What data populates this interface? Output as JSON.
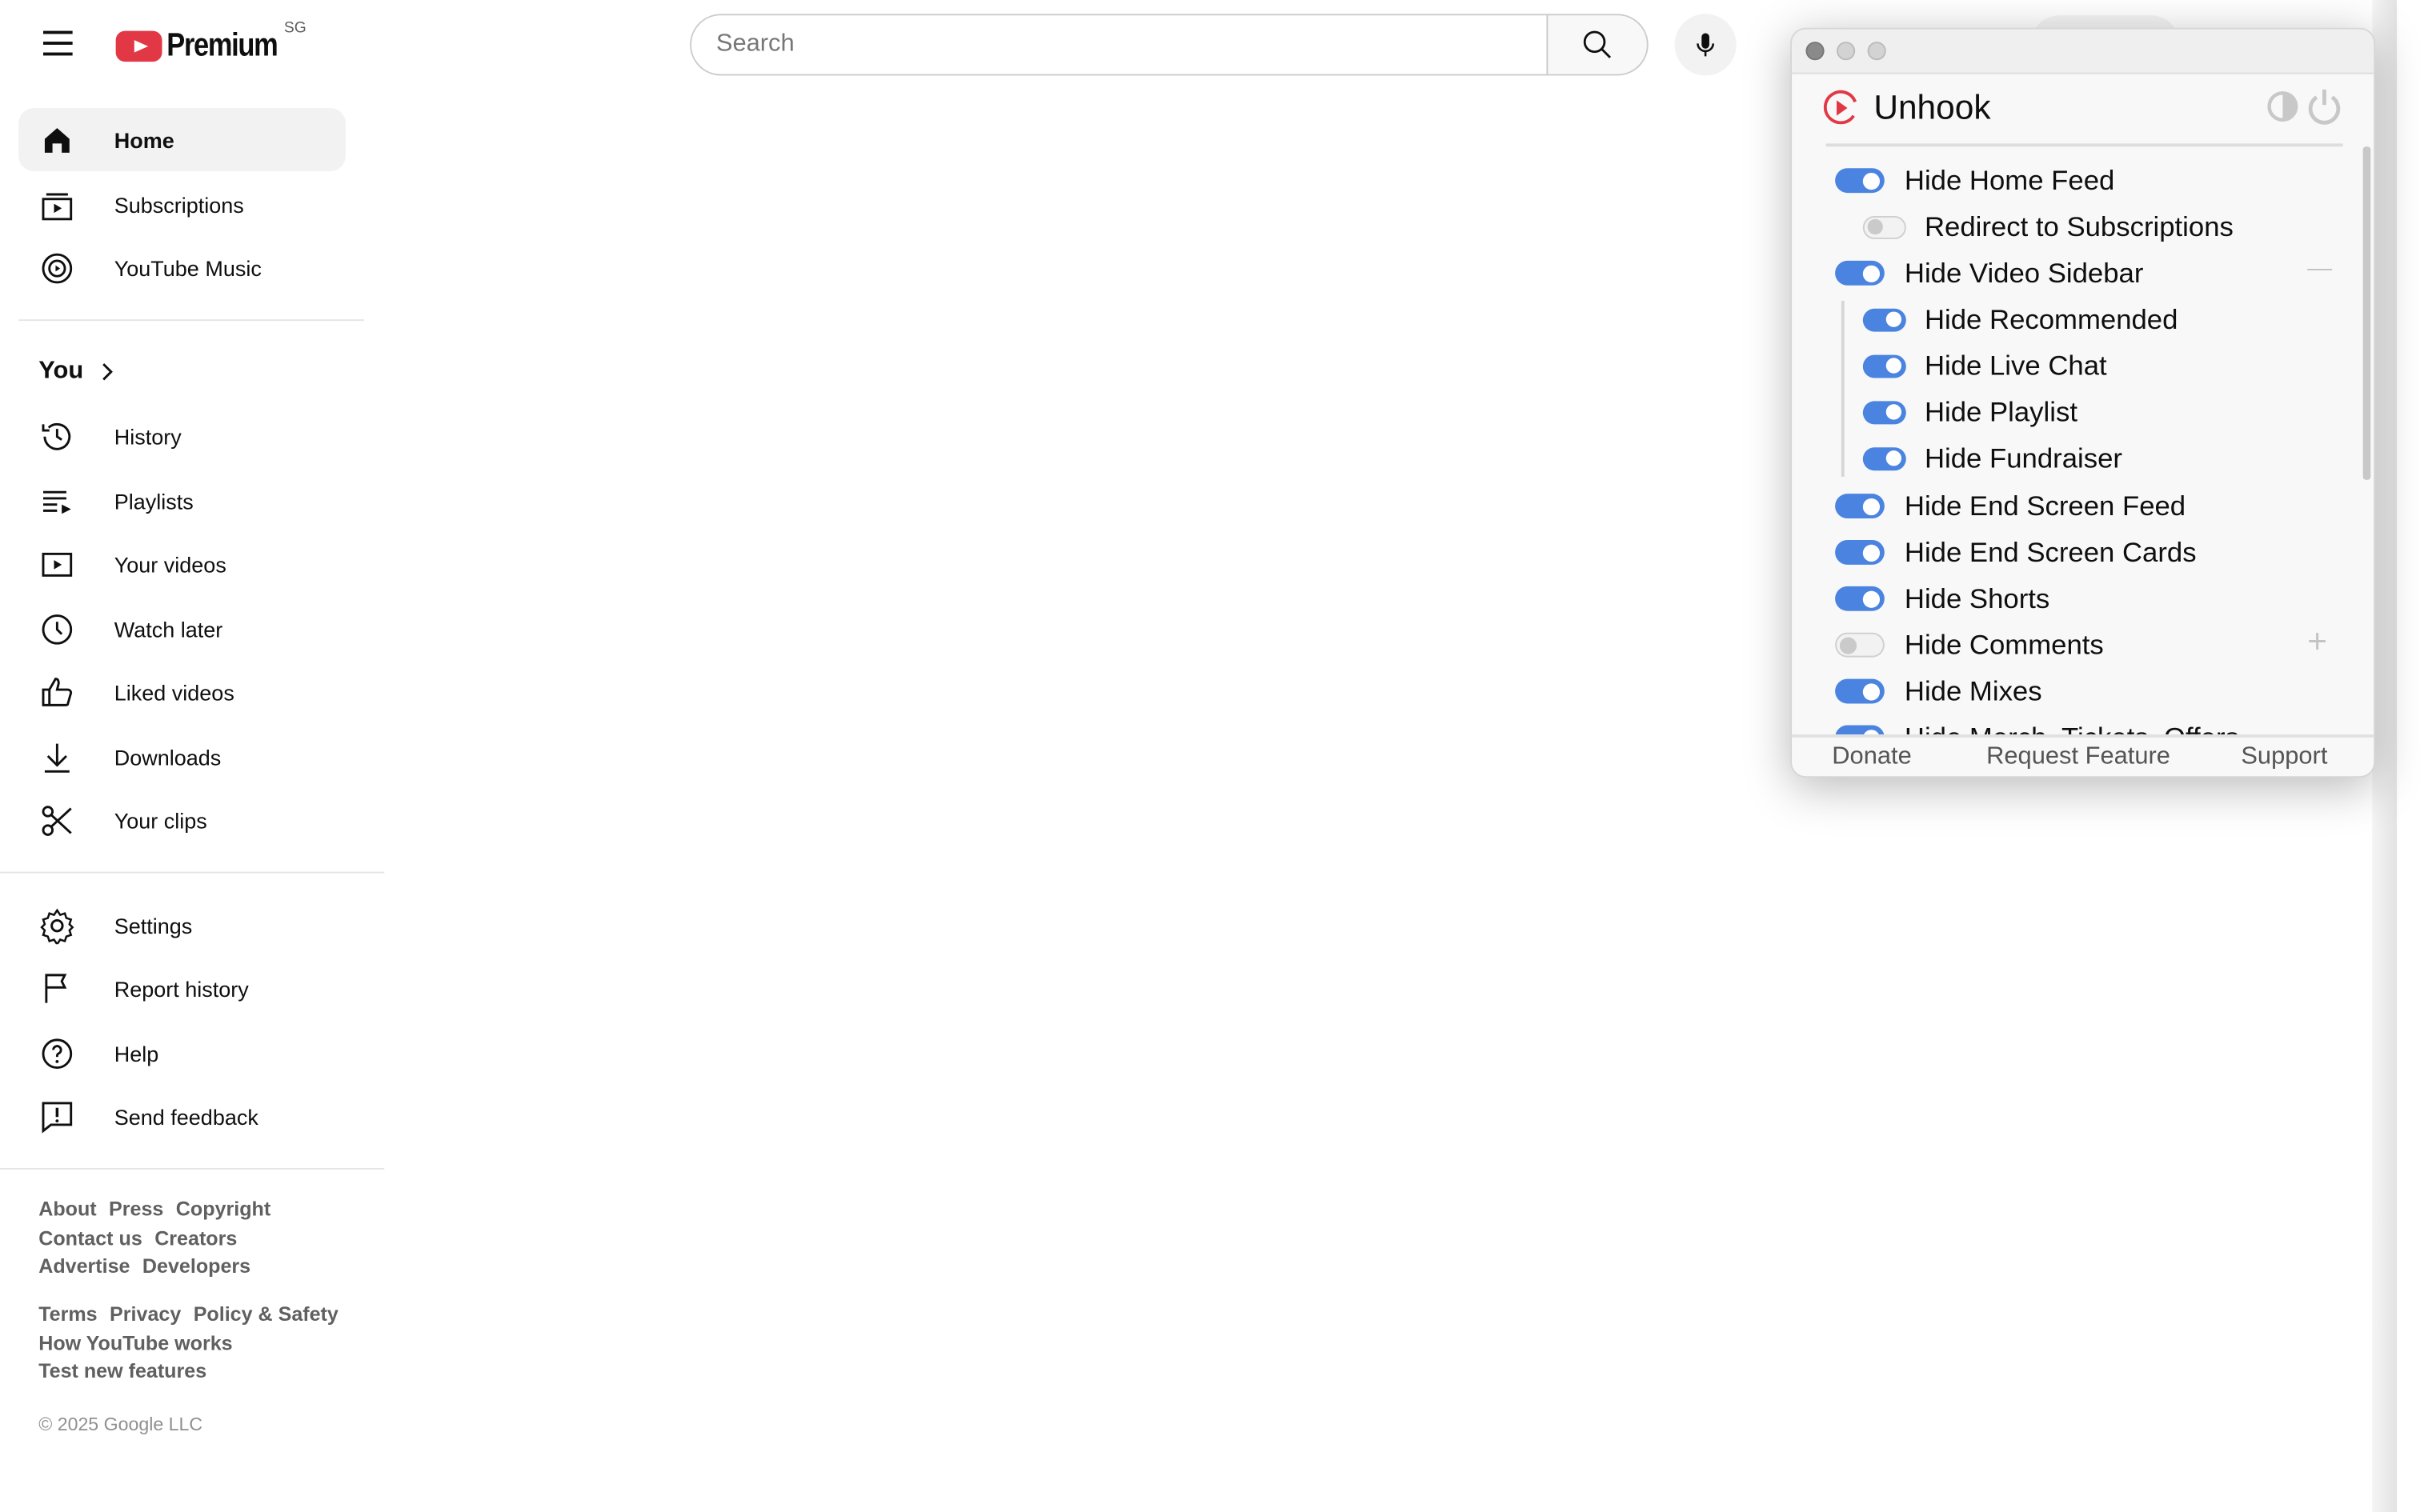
{
  "header": {
    "logo_text": "Premium",
    "region": "SG",
    "search_placeholder": "Search"
  },
  "sidebar": {
    "main": [
      {
        "label": "Home",
        "icon": "home-icon",
        "active": true
      },
      {
        "label": "Subscriptions",
        "icon": "subscriptions-icon"
      },
      {
        "label": "YouTube Music",
        "icon": "youtube-music-icon"
      }
    ],
    "you_label": "You",
    "you_items": [
      {
        "label": "History",
        "icon": "history-icon"
      },
      {
        "label": "Playlists",
        "icon": "playlists-icon"
      },
      {
        "label": "Your videos",
        "icon": "your-videos-icon"
      },
      {
        "label": "Watch later",
        "icon": "watch-later-icon"
      },
      {
        "label": "Liked videos",
        "icon": "thumbs-up-icon"
      },
      {
        "label": "Downloads",
        "icon": "download-icon"
      },
      {
        "label": "Your clips",
        "icon": "scissors-icon"
      }
    ],
    "settings_items": [
      {
        "label": "Settings",
        "icon": "gear-icon"
      },
      {
        "label": "Report history",
        "icon": "flag-icon"
      },
      {
        "label": "Help",
        "icon": "help-icon"
      },
      {
        "label": "Send feedback",
        "icon": "feedback-icon"
      }
    ],
    "footer_links_1": [
      [
        "About",
        "Press",
        "Copyright"
      ],
      [
        "Contact us",
        "Creators"
      ],
      [
        "Advertise",
        "Developers"
      ]
    ],
    "footer_links_2": [
      [
        "Terms",
        "Privacy",
        "Policy & Safety"
      ],
      [
        "How YouTube works"
      ],
      [
        "Test new features"
      ]
    ],
    "copyright": "© 2025 Google LLC"
  },
  "popup": {
    "title": "Unhook",
    "accent": "#4a84e0",
    "items": [
      {
        "label": "Hide Home Feed",
        "on": true,
        "level": 0
      },
      {
        "label": "Redirect to Subscriptions",
        "on": false,
        "level": 1
      },
      {
        "label": "Hide Video Sidebar",
        "on": true,
        "level": 0,
        "control": "collapse"
      },
      {
        "label": "Hide Recommended",
        "on": true,
        "level": 1
      },
      {
        "label": "Hide Live Chat",
        "on": true,
        "level": 1
      },
      {
        "label": "Hide Playlist",
        "on": true,
        "level": 1
      },
      {
        "label": "Hide Fundraiser",
        "on": true,
        "level": 1
      },
      {
        "label": "Hide End Screen Feed",
        "on": true,
        "level": 0
      },
      {
        "label": "Hide End Screen Cards",
        "on": true,
        "level": 0
      },
      {
        "label": "Hide Shorts",
        "on": true,
        "level": 0
      },
      {
        "label": "Hide Comments",
        "on": false,
        "level": 0,
        "control": "expand"
      },
      {
        "label": "Hide Mixes",
        "on": true,
        "level": 0
      },
      {
        "label": "Hide Merch, Tickets, Offers",
        "on": true,
        "level": 0
      }
    ],
    "footer": {
      "donate": "Donate",
      "request": "Request Feature",
      "support": "Support"
    }
  }
}
